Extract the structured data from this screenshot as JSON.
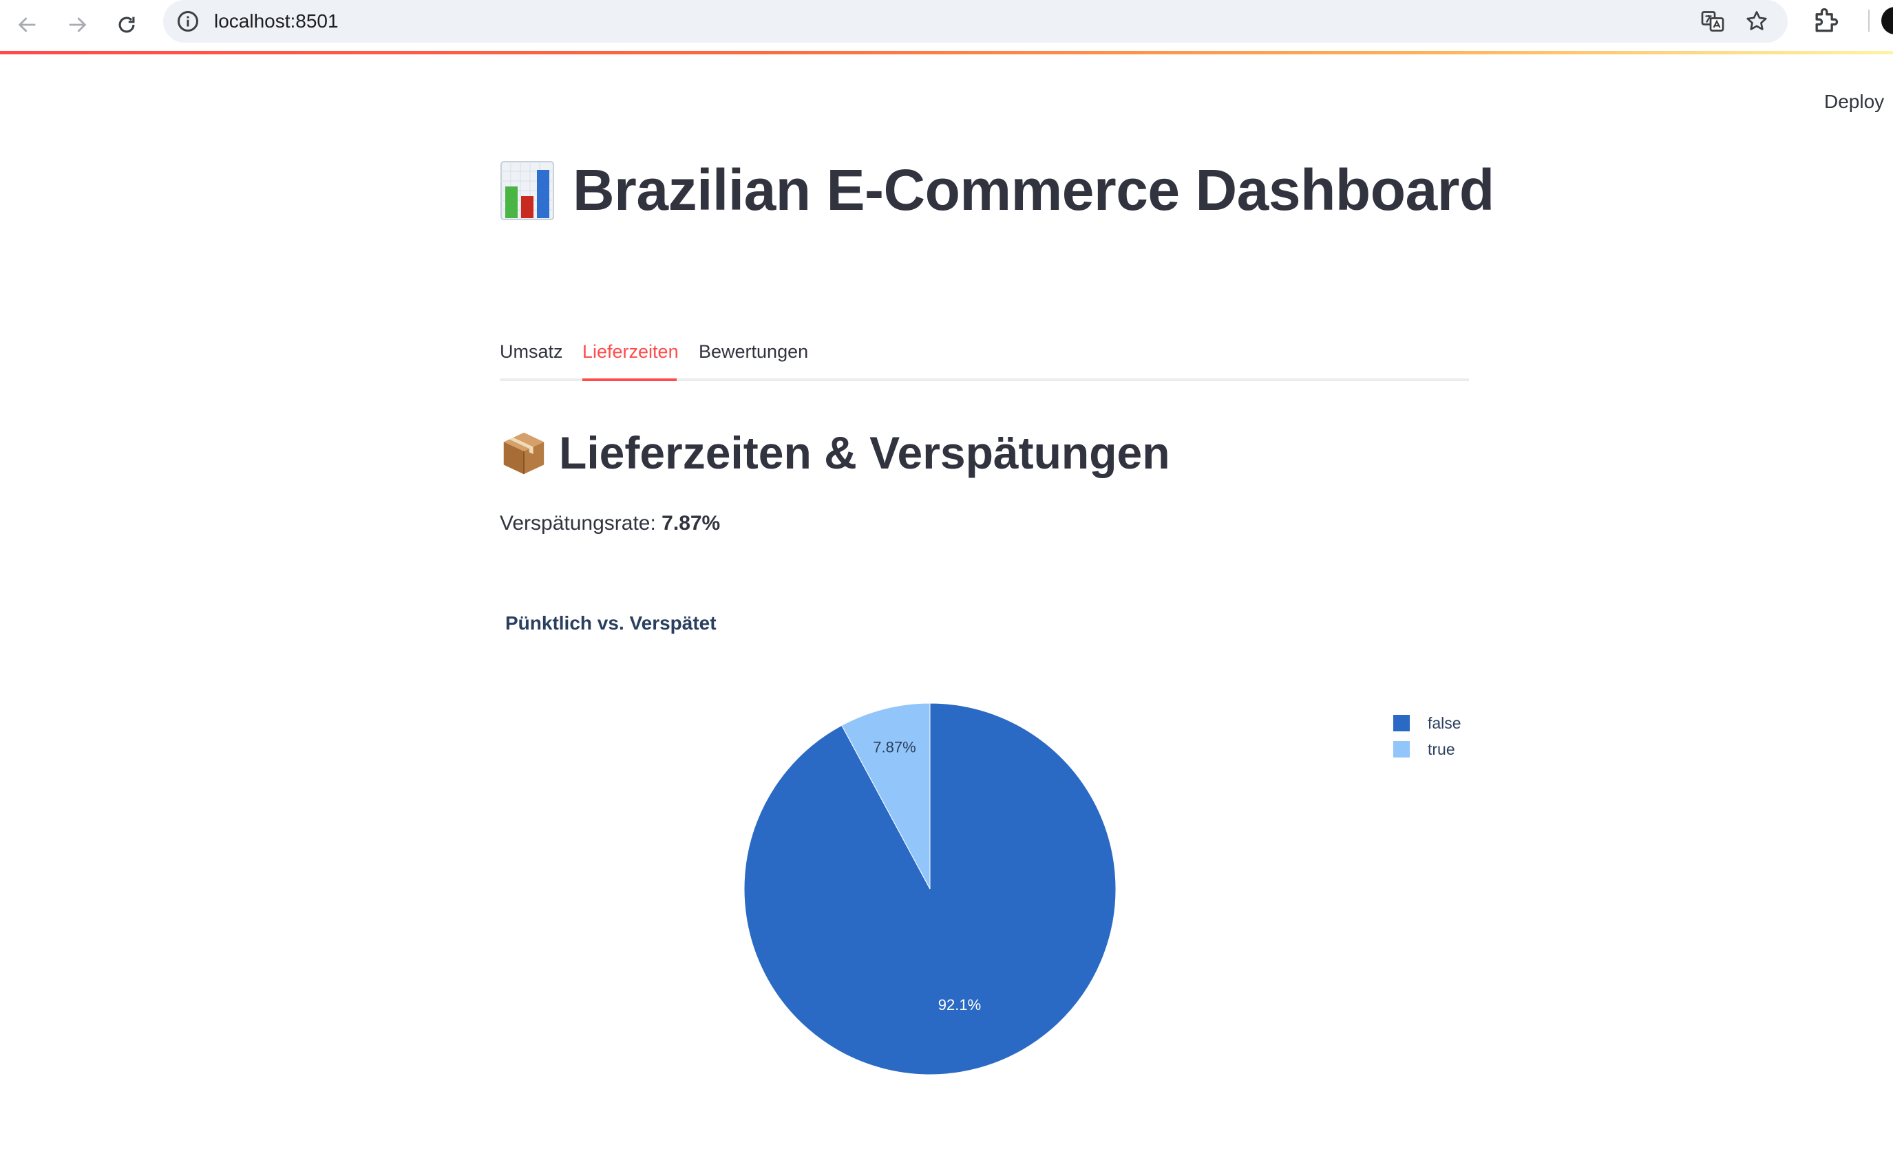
{
  "browser": {
    "url": "localhost:8501"
  },
  "header": {
    "deploy_label": "Deploy"
  },
  "page": {
    "title": "Brazilian E-Commerce Dashboard",
    "title_icon": "bar-chart-emoji"
  },
  "tabs": [
    {
      "label": "Umsatz",
      "active": false
    },
    {
      "label": "Lieferzeiten",
      "active": true
    },
    {
      "label": "Bewertungen",
      "active": false
    }
  ],
  "section": {
    "title": "Lieferzeiten & Verspätungen",
    "title_icon": "package-emoji",
    "rate_label": "Verspätungsrate:",
    "rate_value": "7.87%"
  },
  "colors": {
    "accent": "#ff4b4b",
    "series_false": "#2a6ac4",
    "series_true": "#92c5f9"
  },
  "chart_data": {
    "type": "pie",
    "title": "Pünktlich vs. Verspätet",
    "legend_position": "top-right",
    "labels": [
      "false",
      "true"
    ],
    "values": [
      92.13,
      7.87
    ],
    "slice_labels": [
      "92.1%",
      "7.87%"
    ],
    "colors": [
      "#2a6ac4",
      "#92c5f9"
    ]
  }
}
